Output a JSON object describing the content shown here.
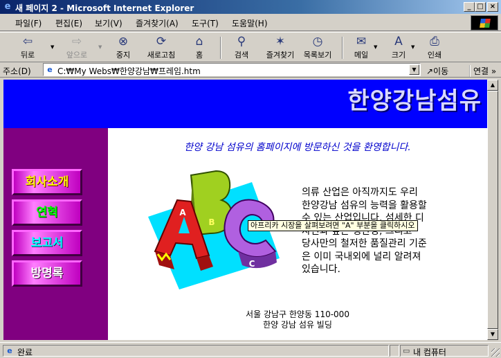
{
  "window": {
    "title": "새 페이지 2 - Microsoft Internet Explorer",
    "minimize": "_",
    "maximize": "□",
    "close": "×"
  },
  "menu": [
    {
      "label": "파일(F)"
    },
    {
      "label": "편집(E)"
    },
    {
      "label": "보기(V)"
    },
    {
      "label": "즐겨찾기(A)"
    },
    {
      "label": "도구(T)"
    },
    {
      "label": "도움말(H)"
    }
  ],
  "toolbar": {
    "back": {
      "label": "뒤로",
      "icon": "back-arrow-icon",
      "glyph": "⇦"
    },
    "forward": {
      "label": "앞으로",
      "icon": "forward-arrow-icon",
      "glyph": "⇨"
    },
    "stop": {
      "label": "중지",
      "icon": "stop-icon",
      "glyph": "⊗"
    },
    "refresh": {
      "label": "새로고침",
      "icon": "refresh-icon",
      "glyph": "⟳"
    },
    "home": {
      "label": "홈",
      "icon": "home-icon",
      "glyph": "⌂"
    },
    "search": {
      "label": "검색",
      "icon": "search-icon",
      "glyph": "⚲"
    },
    "favorites": {
      "label": "즐겨찾기",
      "icon": "favorites-icon",
      "glyph": "✶"
    },
    "history": {
      "label": "목록보기",
      "icon": "history-icon",
      "glyph": "◷"
    },
    "mail": {
      "label": "메일",
      "icon": "mail-icon",
      "glyph": "✉"
    },
    "size": {
      "label": "크기",
      "icon": "font-size-icon",
      "glyph": "A"
    },
    "print": {
      "label": "인쇄",
      "icon": "print-icon",
      "glyph": "⎙"
    }
  },
  "address": {
    "label": "주소(D)",
    "value": "C:₩My Webs₩한양강남₩프레임.htm",
    "go_label": "↗이동",
    "links_label": "연결 »"
  },
  "page": {
    "banner_title": "한양강남섬유",
    "menu": [
      {
        "label": "회사소개"
      },
      {
        "label": "연혁"
      },
      {
        "label": "보고서"
      },
      {
        "label": "방명록"
      }
    ],
    "welcome": "한양 강남 섬유의 홈페이지에 방문하신 것을 환영합니다.",
    "intro_lines": [
      "의류 산업은 아직까지도 우리",
      "한양강남 섬유의 능력을 활용할",
      "수 있는 산업입니다. 섬세한 디",
      "자인과 높은 생산성, 그리고",
      "당사만의 철저한 품질관리 기준",
      "은 이미 국내외에 널리 알려져",
      "있습니다."
    ],
    "tooltip": "아프리카 시장을 살펴보려면 \"A\" 부분을 클릭하시오",
    "address_line1": "서울 강남구 한양동 110-000",
    "address_line2": "한양 강남 섬유 빌딩",
    "clipart_letters": [
      "A",
      "B",
      "C"
    ],
    "colors": {
      "banner_bg": "#0000ff",
      "sidebar_bg": "#800080",
      "welcome_text": "#0000cc"
    }
  },
  "status": {
    "text": "완료",
    "zone": "내 컴퓨터"
  }
}
